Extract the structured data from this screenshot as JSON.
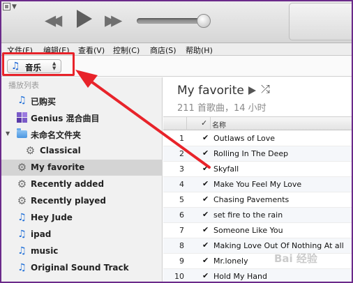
{
  "menu": [
    "文件(F)",
    "编辑(E)",
    "查看(V)",
    "控制(C)",
    "商店(S)",
    "帮助(H)"
  ],
  "source_select": {
    "label": "音乐"
  },
  "sidebar": {
    "header": "播放列表",
    "items": [
      {
        "label": "已购买",
        "icon": "music-note-icon"
      },
      {
        "label": "Genius 混合曲目",
        "icon": "genius-icon"
      },
      {
        "label": "未命名文件夹",
        "icon": "folder-icon"
      },
      {
        "label": "Classical",
        "icon": "gear-icon"
      },
      {
        "label": "My favorite",
        "icon": "gear-icon",
        "selected": true
      },
      {
        "label": "Recently added",
        "icon": "gear-icon"
      },
      {
        "label": "Recently played",
        "icon": "gear-icon"
      },
      {
        "label": "Hey Jude",
        "icon": "music-note-icon"
      },
      {
        "label": "ipad",
        "icon": "music-note-icon"
      },
      {
        "label": "music",
        "icon": "music-note-icon"
      },
      {
        "label": "Original Sound Track",
        "icon": "music-note-icon"
      }
    ]
  },
  "main": {
    "title": "My favorite",
    "subtitle": "211 首歌曲，14 小时",
    "columns": {
      "check": "✓",
      "name": "名称"
    },
    "rows": [
      {
        "num": "1",
        "name": "Outlaws of Love"
      },
      {
        "num": "2",
        "name": "Rolling In The Deep"
      },
      {
        "num": "3",
        "name": "Skyfall"
      },
      {
        "num": "4",
        "name": "Make You Feel My Love"
      },
      {
        "num": "5",
        "name": "Chasing Pavements"
      },
      {
        "num": "6",
        "name": "set fire to the rain"
      },
      {
        "num": "7",
        "name": "Someone Like You"
      },
      {
        "num": "8",
        "name": "Making Love Out Of Nothing At all"
      },
      {
        "num": "9",
        "name": "Mr.lonely"
      },
      {
        "num": "10",
        "name": "Hold My Hand"
      }
    ]
  },
  "watermark": "Bai 经验",
  "colors": {
    "annotation": "#e8232a",
    "accent": "#1f6fd8",
    "selected_row": "#d4d4d4"
  }
}
